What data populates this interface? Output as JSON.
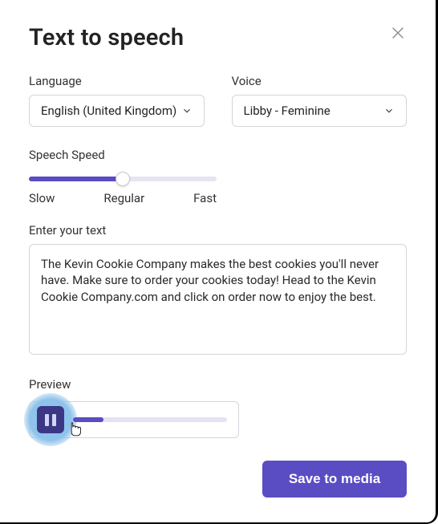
{
  "title": "Text to speech",
  "close_label": "Close",
  "language": {
    "label": "Language",
    "value": "English (United Kingdom)"
  },
  "voice": {
    "label": "Voice",
    "value": "Libby - Feminine"
  },
  "speed": {
    "label": "Speech Speed",
    "value_percent": 50,
    "ticks": {
      "slow": "Slow",
      "regular": "Regular",
      "fast": "Fast"
    }
  },
  "textarea": {
    "label": "Enter your text",
    "value": "The Kevin Cookie Company makes the best cookies you'll never have. Make sure to order your cookies today! Head to the Kevin Cookie Company.com and click on order now to enjoy the best."
  },
  "preview": {
    "label": "Preview",
    "progress_percent": 20
  },
  "save_label": "Save to media",
  "colors": {
    "accent": "#5a4cc3"
  }
}
